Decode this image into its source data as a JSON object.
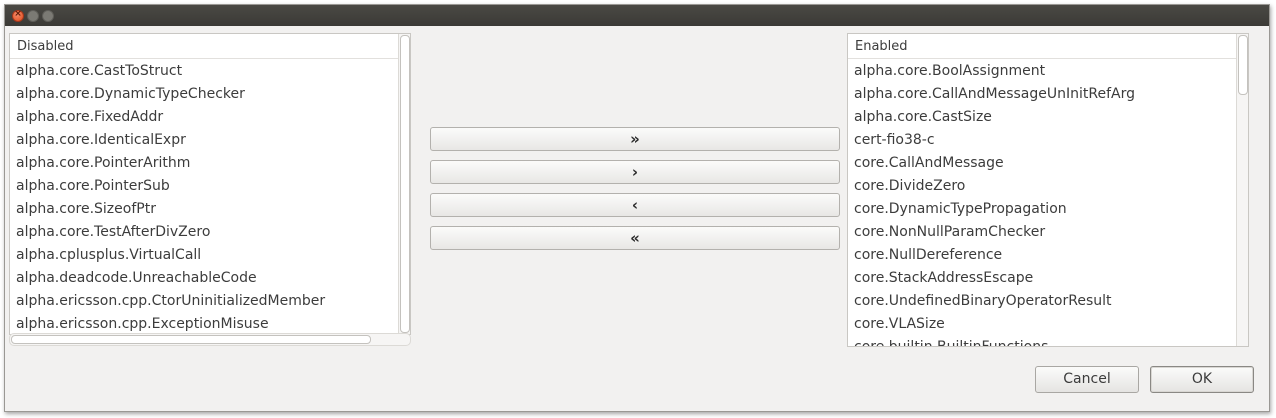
{
  "window": {
    "close_glyph": "×"
  },
  "disabled_panel": {
    "header": "Disabled",
    "items": [
      "alpha.core.CastToStruct",
      "alpha.core.DynamicTypeChecker",
      "alpha.core.FixedAddr",
      "alpha.core.IdenticalExpr",
      "alpha.core.PointerArithm",
      "alpha.core.PointerSub",
      "alpha.core.SizeofPtr",
      "alpha.core.TestAfterDivZero",
      "alpha.cplusplus.VirtualCall",
      "alpha.deadcode.UnreachableCode",
      "alpha.ericsson.cpp.CtorUninitializedMember",
      "alpha.ericsson.cpp.ExceptionMisuse"
    ]
  },
  "enabled_panel": {
    "header": "Enabled",
    "items": [
      "alpha.core.BoolAssignment",
      "alpha.core.CallAndMessageUnInitRefArg",
      "alpha.core.CastSize",
      "cert-fio38-c",
      "core.CallAndMessage",
      "core.DivideZero",
      "core.DynamicTypePropagation",
      "core.NonNullParamChecker",
      "core.NullDereference",
      "core.StackAddressEscape",
      "core.UndefinedBinaryOperatorResult",
      "core.VLASize",
      "core.builtin.BuiltinFunctions"
    ]
  },
  "move_buttons": {
    "add_all": "»",
    "add": "›",
    "remove": "‹",
    "remove_all": "«"
  },
  "dialog_buttons": {
    "cancel": "Cancel",
    "ok": "OK"
  }
}
